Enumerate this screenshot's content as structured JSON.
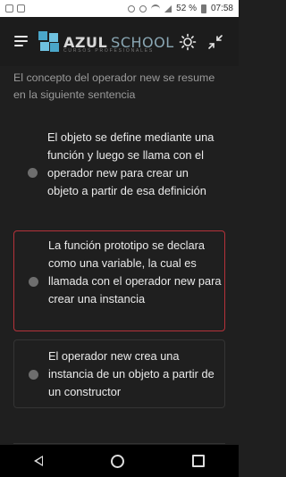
{
  "status_bar": {
    "battery": "52 %",
    "time": "07:58"
  },
  "header": {
    "logo_azul": "AZUL",
    "logo_school": "SCHOOL",
    "logo_tagline": "CURSOS PROFESIONALES"
  },
  "quiz": {
    "question": "El concepto del operador new se resume en la siguiente sentencia",
    "options": [
      {
        "label": "El objeto se define mediante una función y luego se llama con el operador new para crear un objeto a partir de esa definición",
        "state": "unselected"
      },
      {
        "label": "La función prototipo se declara como una variable, la cual es llamada con el operador new para crear una instancia",
        "state": "highlighted-error"
      },
      {
        "label": "El operador new crea una instancia de un objeto a partir de un constructor",
        "state": "unselected"
      }
    ]
  },
  "colors": {
    "background": "#1f1f1f",
    "accent_error": "#b5323a",
    "logo_blue": "#4aa6c9"
  }
}
